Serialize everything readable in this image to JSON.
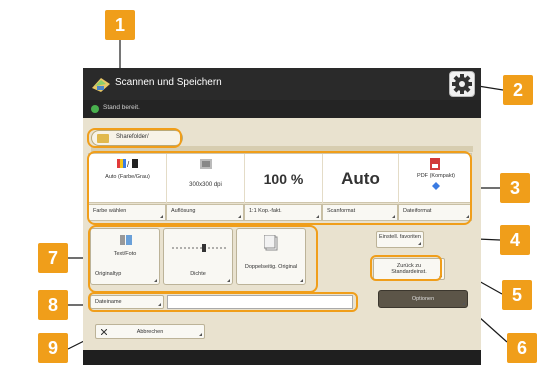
{
  "callouts": [
    "1",
    "2",
    "3",
    "4",
    "5",
    "6",
    "7",
    "8",
    "9"
  ],
  "window": {
    "title": "Scannen und Speichern",
    "status": "Stand bereit."
  },
  "destination": {
    "label": "Sharefolder/"
  },
  "settings": [
    {
      "top": "Auto (Farbe/Grau)",
      "bottom": "Farbe wählen"
    },
    {
      "top": "300x300 dpi",
      "bottom": "Auflösung"
    },
    {
      "top": "100 %",
      "bottom": "1:1   Kop.-fakt."
    },
    {
      "top": "Auto",
      "bottom": "Scanformat"
    },
    {
      "top": "PDF (Kompakt)",
      "bottom": "Dateiformat"
    }
  ],
  "originaltyp": {
    "value": "Text/Foto",
    "label": "Originaltyp"
  },
  "dichte": {
    "label": "Dichte"
  },
  "doppelseitig": {
    "label": "Doppelseitig. Original"
  },
  "dateiname": {
    "label": "Dateiname",
    "value": ""
  },
  "favoriten": {
    "label": "Einstell. favoriten"
  },
  "zurueck": {
    "label": "Zurück zu Standardeinst."
  },
  "optionen": {
    "label": "Optionen"
  },
  "abbrechen": {
    "label": "Abbrechen"
  },
  "colors": {
    "callout": "#f09e1a",
    "screen_bg": "#e9e2cf",
    "titlebar": "#2a2a2a"
  }
}
